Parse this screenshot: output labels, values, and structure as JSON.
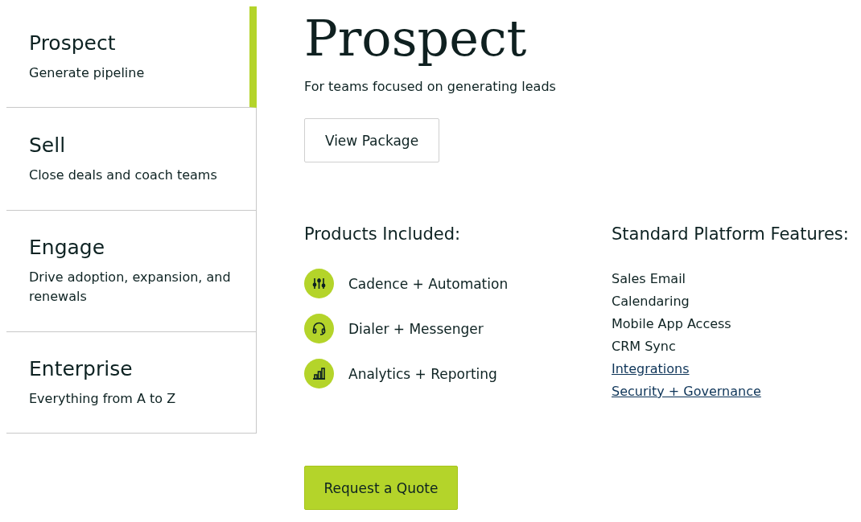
{
  "tiers": [
    {
      "title": "Prospect",
      "subtitle": "Generate pipeline",
      "selected": true
    },
    {
      "title": "Sell",
      "subtitle": "Close deals and coach teams",
      "selected": false
    },
    {
      "title": "Engage",
      "subtitle": "Drive adoption, expansion, and renewals",
      "selected": false
    },
    {
      "title": "Enterprise",
      "subtitle": "Everything from A to Z",
      "selected": false
    }
  ],
  "detail": {
    "title": "Prospect",
    "tagline": "For teams focused on generating leads",
    "view_button": "View Package",
    "products_heading": "Products Included:",
    "products": [
      {
        "label": "Cadence + Automation"
      },
      {
        "label": "Dialer + Messenger"
      },
      {
        "label": "Analytics + Reporting"
      }
    ],
    "features_heading": "Standard Platform Features:",
    "features": [
      {
        "label": "Sales Email",
        "kind": "text"
      },
      {
        "label": "Calendaring",
        "kind": "text"
      },
      {
        "label": "Mobile App Access",
        "kind": "text"
      },
      {
        "label": "CRM Sync",
        "kind": "text"
      },
      {
        "label": "Integrations",
        "kind": "link"
      },
      {
        "label": "Security + Governance",
        "kind": "link"
      }
    ],
    "quote_button": "Request a Quote"
  }
}
